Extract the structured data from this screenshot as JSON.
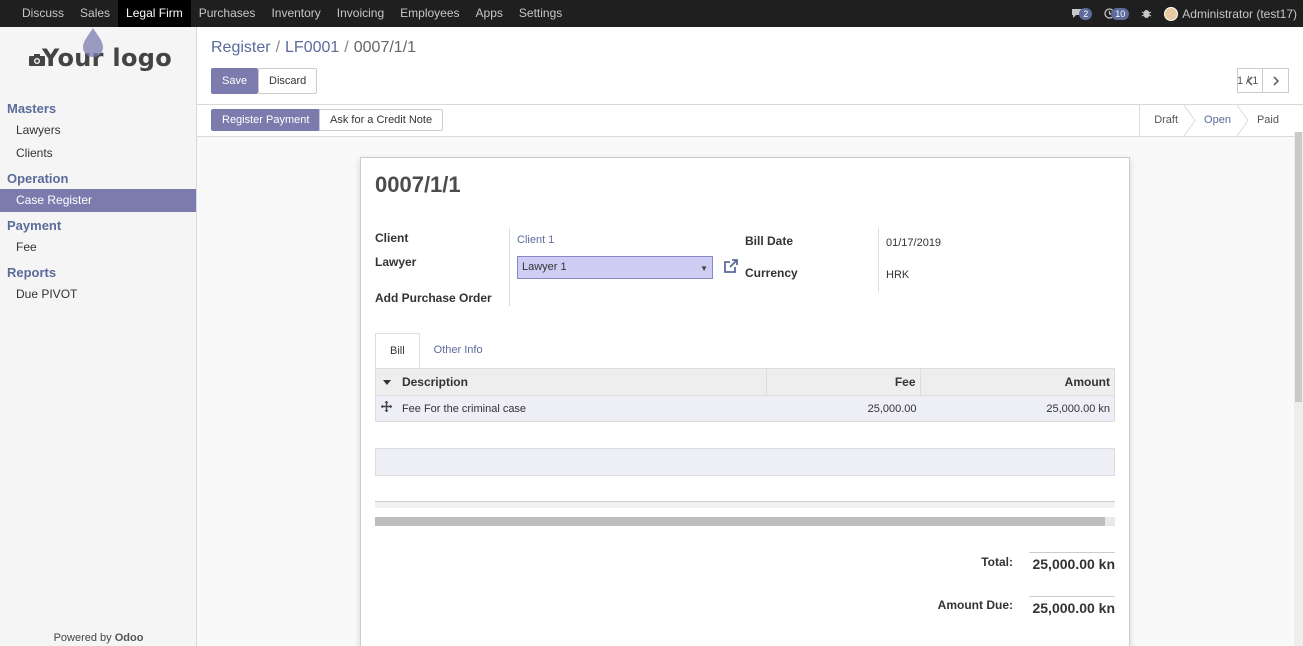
{
  "topmenu": {
    "items": [
      "Discuss",
      "Sales",
      "Legal Firm",
      "Purchases",
      "Inventory",
      "Invoicing",
      "Employees",
      "Apps",
      "Settings"
    ],
    "active": "Legal Firm",
    "messages_count": "2",
    "activities_count": "10",
    "user": "Administrator (test17)"
  },
  "sidebar": {
    "logo_text": "Your logo",
    "sections": [
      {
        "title": "Masters",
        "items": [
          "Lawyers",
          "Clients"
        ]
      },
      {
        "title": "Operation",
        "items": [
          "Case Register"
        ]
      },
      {
        "title": "Payment",
        "items": [
          "Fee"
        ]
      },
      {
        "title": "Reports",
        "items": [
          "Due PIVOT"
        ]
      }
    ],
    "powered_by": "Powered by",
    "powered_brand": "Odoo"
  },
  "breadcrumb": {
    "items": [
      "Register",
      "LF0001"
    ],
    "current": "0007/1/1"
  },
  "buttons": {
    "save": "Save",
    "discard": "Discard",
    "register_payment": "Register Payment",
    "credit_note": "Ask for a Credit Note"
  },
  "pager": {
    "value": "1 / 1"
  },
  "status": {
    "stages": [
      "Draft",
      "Open",
      "Paid"
    ],
    "selected": "Open"
  },
  "form": {
    "title": "0007/1/1",
    "client_label": "Client",
    "client_value": "Client 1",
    "lawyer_label": "Lawyer",
    "lawyer_value": "Lawyer 1",
    "purchase_label": "Add Purchase Order",
    "bill_date_label": "Bill Date",
    "bill_date_value": "01/17/2019",
    "currency_label": "Currency",
    "currency_value": "HRK",
    "tabs": [
      "Bill",
      "Other Info"
    ],
    "columns": [
      "Description",
      "Fee",
      "Amount"
    ],
    "lines": [
      {
        "description": "Fee For the criminal case",
        "fee": "25,000.00",
        "amount": "25,000.00 kn"
      }
    ],
    "total_label": "Total:",
    "total_value": "25,000.00 kn",
    "due_label": "Amount Due:",
    "due_value": "25,000.00 kn"
  },
  "colors": {
    "accent": "#7c7bad",
    "link": "#5b6b9b",
    "topbar": "#1f1f1f"
  }
}
